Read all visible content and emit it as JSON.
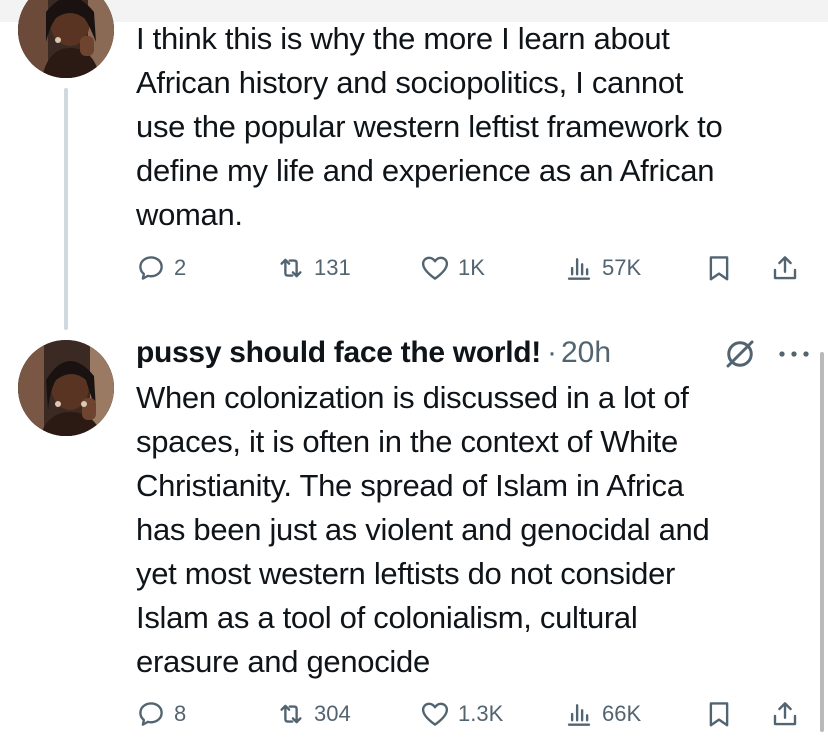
{
  "tweets": [
    {
      "text": "I think this is why the more I learn about\nAfrican history and sociopolitics, I cannot\nuse the popular western leftist framework to\ndefine my life and experience as an African\nwoman.",
      "reply_count": "2",
      "retweet_count": "131",
      "like_count": "1K",
      "view_count": "57K"
    },
    {
      "display_name": "pussy should face the world!",
      "separator": "·",
      "time": "20h",
      "text": "When colonization is discussed in a lot of\nspaces, it is often in the context of White\nChristianity. The spread of Islam in Africa\nhas been just as violent and genocidal and\nyet most western leftists do not consider\nIslam as a tool of colonialism, cultural\nerasure and genocide",
      "reply_count": "8",
      "retweet_count": "304",
      "like_count": "1.3K",
      "view_count": "66K"
    }
  ],
  "icons": {
    "reply": "reply-icon",
    "retweet": "retweet-icon",
    "like": "heart-icon",
    "views": "views-icon",
    "bookmark": "bookmark-icon",
    "share": "share-icon",
    "grok": "grok-icon",
    "more": "more-icon"
  },
  "colors": {
    "text": "#0f1419",
    "secondary": "#536471",
    "thread_line": "#cfd9de"
  }
}
